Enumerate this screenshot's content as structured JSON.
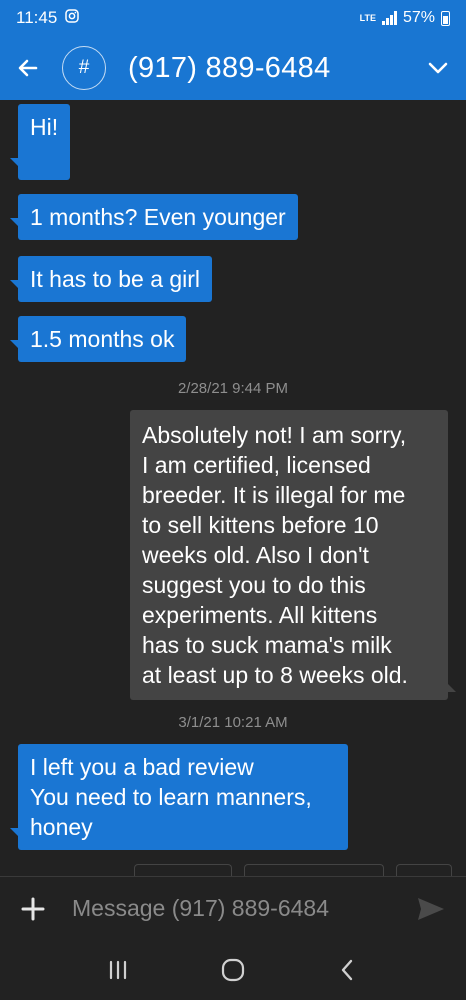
{
  "status_bar": {
    "time": "11:45",
    "network": "LTE",
    "battery": "57%"
  },
  "header": {
    "avatar_symbol": "#",
    "contact": "(917) 889-6484"
  },
  "messages": [
    {
      "direction": "in",
      "text": "Hi!"
    },
    {
      "direction": "in",
      "text": "1 months? Even younger"
    },
    {
      "direction": "in",
      "text": "It has to be a girl"
    },
    {
      "direction": "in",
      "text": "1.5 months ok"
    },
    {
      "direction": "timestamp",
      "text": "2/28/21 9:44 PM"
    },
    {
      "direction": "out",
      "lines": [
        "Absolutely not!  I am sorry,",
        "I am certified,  licensed",
        "breeder.  It is illegal for me",
        "to sell kittens before 10",
        "weeks old. Also I don't",
        "suggest you to do this",
        "experiments. All kittens",
        "has to suck mama's milk",
        "at least up to 8 weeks old."
      ]
    },
    {
      "direction": "timestamp",
      "text": "3/1/21 10:21 AM"
    },
    {
      "direction": "in",
      "lines": [
        "I left you a bad review",
        "You need to learn manners,",
        "honey"
      ]
    }
  ],
  "composer": {
    "placeholder": "Message (917) 889-6484"
  },
  "colors": {
    "accent": "#1976d2",
    "incoming_bubble": "#1a76d3",
    "outgoing_bubble": "#444444",
    "background": "#222222"
  },
  "icons": {
    "back": "arrow-left-icon",
    "expand": "chevron-down-icon",
    "attach": "plus-icon",
    "send": "send-icon",
    "recents": "recents-icon",
    "home": "home-icon",
    "nav_back": "nav-back-icon"
  }
}
